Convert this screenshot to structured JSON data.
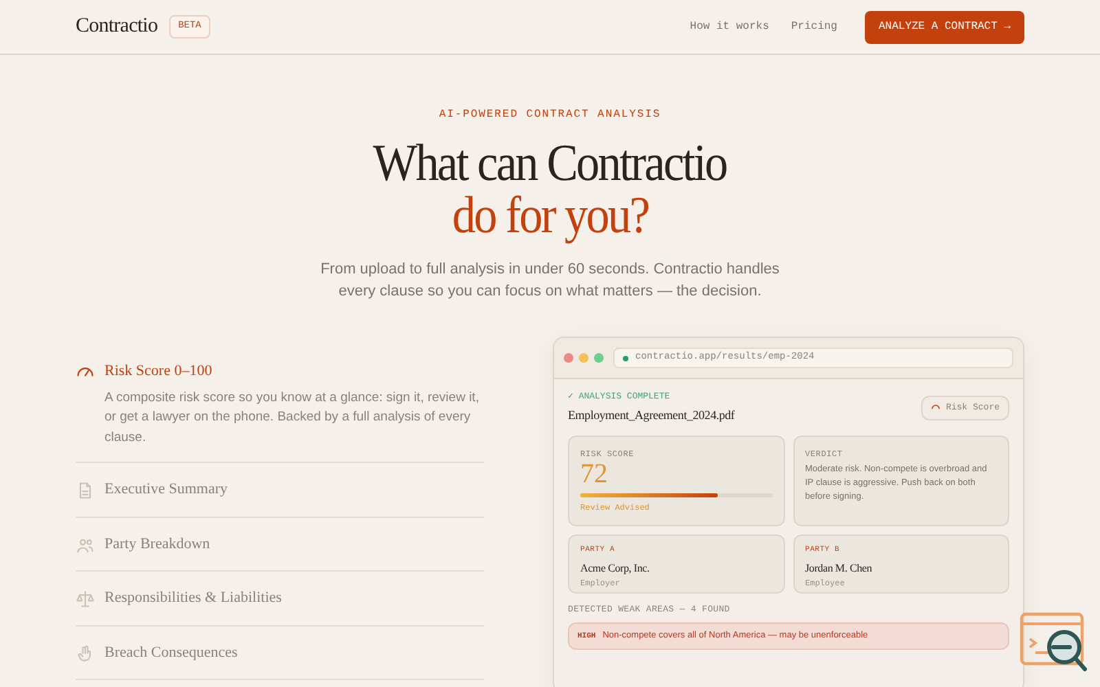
{
  "nav": {
    "logo": "Contractio",
    "badge": "BETA",
    "links": [
      "How it works",
      "Pricing"
    ],
    "cta": "ANALYZE A CONTRACT →"
  },
  "hero": {
    "eyebrow": "AI-POWERED CONTRACT ANALYSIS",
    "title_line_1": "What can Contractio",
    "title_line_2": "do for you?",
    "subtitle": "From upload to full analysis in under 60 seconds. Contractio handles every clause so you can focus on what matters — the decision."
  },
  "features": [
    {
      "kind": "gauge",
      "title": "Risk Score 0–100",
      "expanded": true,
      "description": "A composite risk score so you know at a glance: sign it, review it, or get a lawyer on the phone. Backed by a full analysis of every clause."
    },
    {
      "kind": "document",
      "title": "Executive Summary",
      "expanded": false
    },
    {
      "kind": "people",
      "title": "Party Breakdown",
      "expanded": false
    },
    {
      "kind": "scale",
      "title": "Responsibilities & Liabilities",
      "expanded": false
    },
    {
      "kind": "hand",
      "title": "Breach Consequences",
      "expanded": false
    }
  ],
  "preview": {
    "url": "contractio.app/results/emp-2024",
    "status": "✓ ANALYSIS COMPLETE",
    "filename": "Employment_Agreement_2024.pdf",
    "tab_button": "Risk Score",
    "risk": {
      "label": "RISK SCORE",
      "value": "72",
      "level": 0.72,
      "caption": "Review Advised"
    },
    "verdict": {
      "label": "VERDICT",
      "text": "Moderate risk. Non-compete is overbroad and IP clause is aggressive. Push back on both before signing."
    },
    "parties": [
      {
        "label": "PARTY A",
        "name": "Acme Corp, Inc.",
        "role": "Employer"
      },
      {
        "label": "PARTY B",
        "name": "Jordan M. Chen",
        "role": "Employee"
      }
    ],
    "weak_areas_heading": "DETECTED WEAK AREAS — 4 FOUND",
    "weak_areas": [
      {
        "kind": "high",
        "tag": "HIGH",
        "text": "Non-compete covers all of North America — may be unenforceable"
      }
    ]
  }
}
